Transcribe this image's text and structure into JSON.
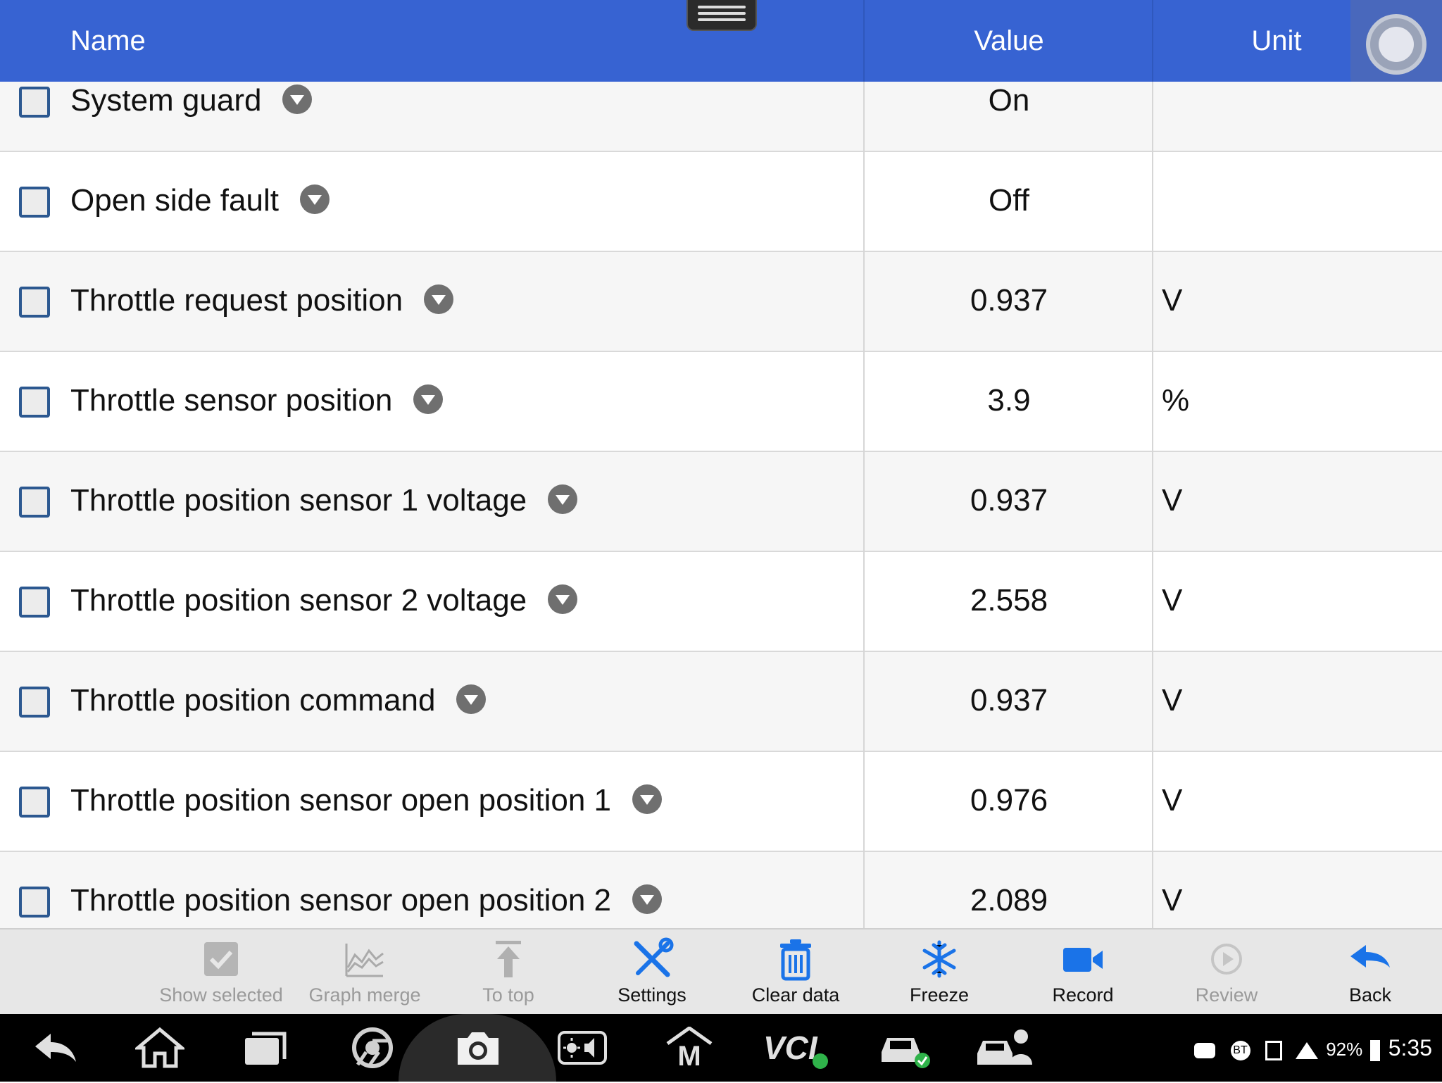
{
  "header": {
    "name_col": "Name",
    "value_col": "Value",
    "unit_col": "Unit"
  },
  "rows": [
    {
      "name": "System guard",
      "value": "On",
      "unit": ""
    },
    {
      "name": "Open side fault",
      "value": "Off",
      "unit": ""
    },
    {
      "name": "Throttle request position",
      "value": "0.937",
      "unit": "V"
    },
    {
      "name": "Throttle sensor position",
      "value": "3.9",
      "unit": "%"
    },
    {
      "name": "Throttle position sensor 1 voltage",
      "value": "0.937",
      "unit": "V"
    },
    {
      "name": "Throttle position sensor 2 voltage",
      "value": "2.558",
      "unit": "V"
    },
    {
      "name": "Throttle position command",
      "value": "0.937",
      "unit": "V"
    },
    {
      "name": "Throttle position sensor open position 1",
      "value": "0.976",
      "unit": "V"
    },
    {
      "name": "Throttle position sensor open position 2",
      "value": "2.089",
      "unit": "V"
    }
  ],
  "toolbar": {
    "show_selected": "Show selected",
    "graph_merge": "Graph merge",
    "to_top": "To top",
    "settings": "Settings",
    "clear_data": "Clear data",
    "freeze": "Freeze",
    "record": "Record",
    "review": "Review",
    "back": "Back"
  },
  "navbar": {
    "icons": [
      "back-arrow-icon",
      "home-icon",
      "recent-apps-icon",
      "chrome-icon",
      "camera-icon",
      "brightness-volume-icon",
      "maxifix-m-icon",
      "vci-icon",
      "car-icon",
      "car-user-icon"
    ],
    "vci_label": "VCI",
    "m_label": "M"
  },
  "status": {
    "bt": "BT",
    "battery": "92%",
    "time": "5:35"
  },
  "colors": {
    "header_bg": "#3763d2",
    "accent_blue": "#1a73e8",
    "disabled_gray": "#9a9a9a"
  }
}
